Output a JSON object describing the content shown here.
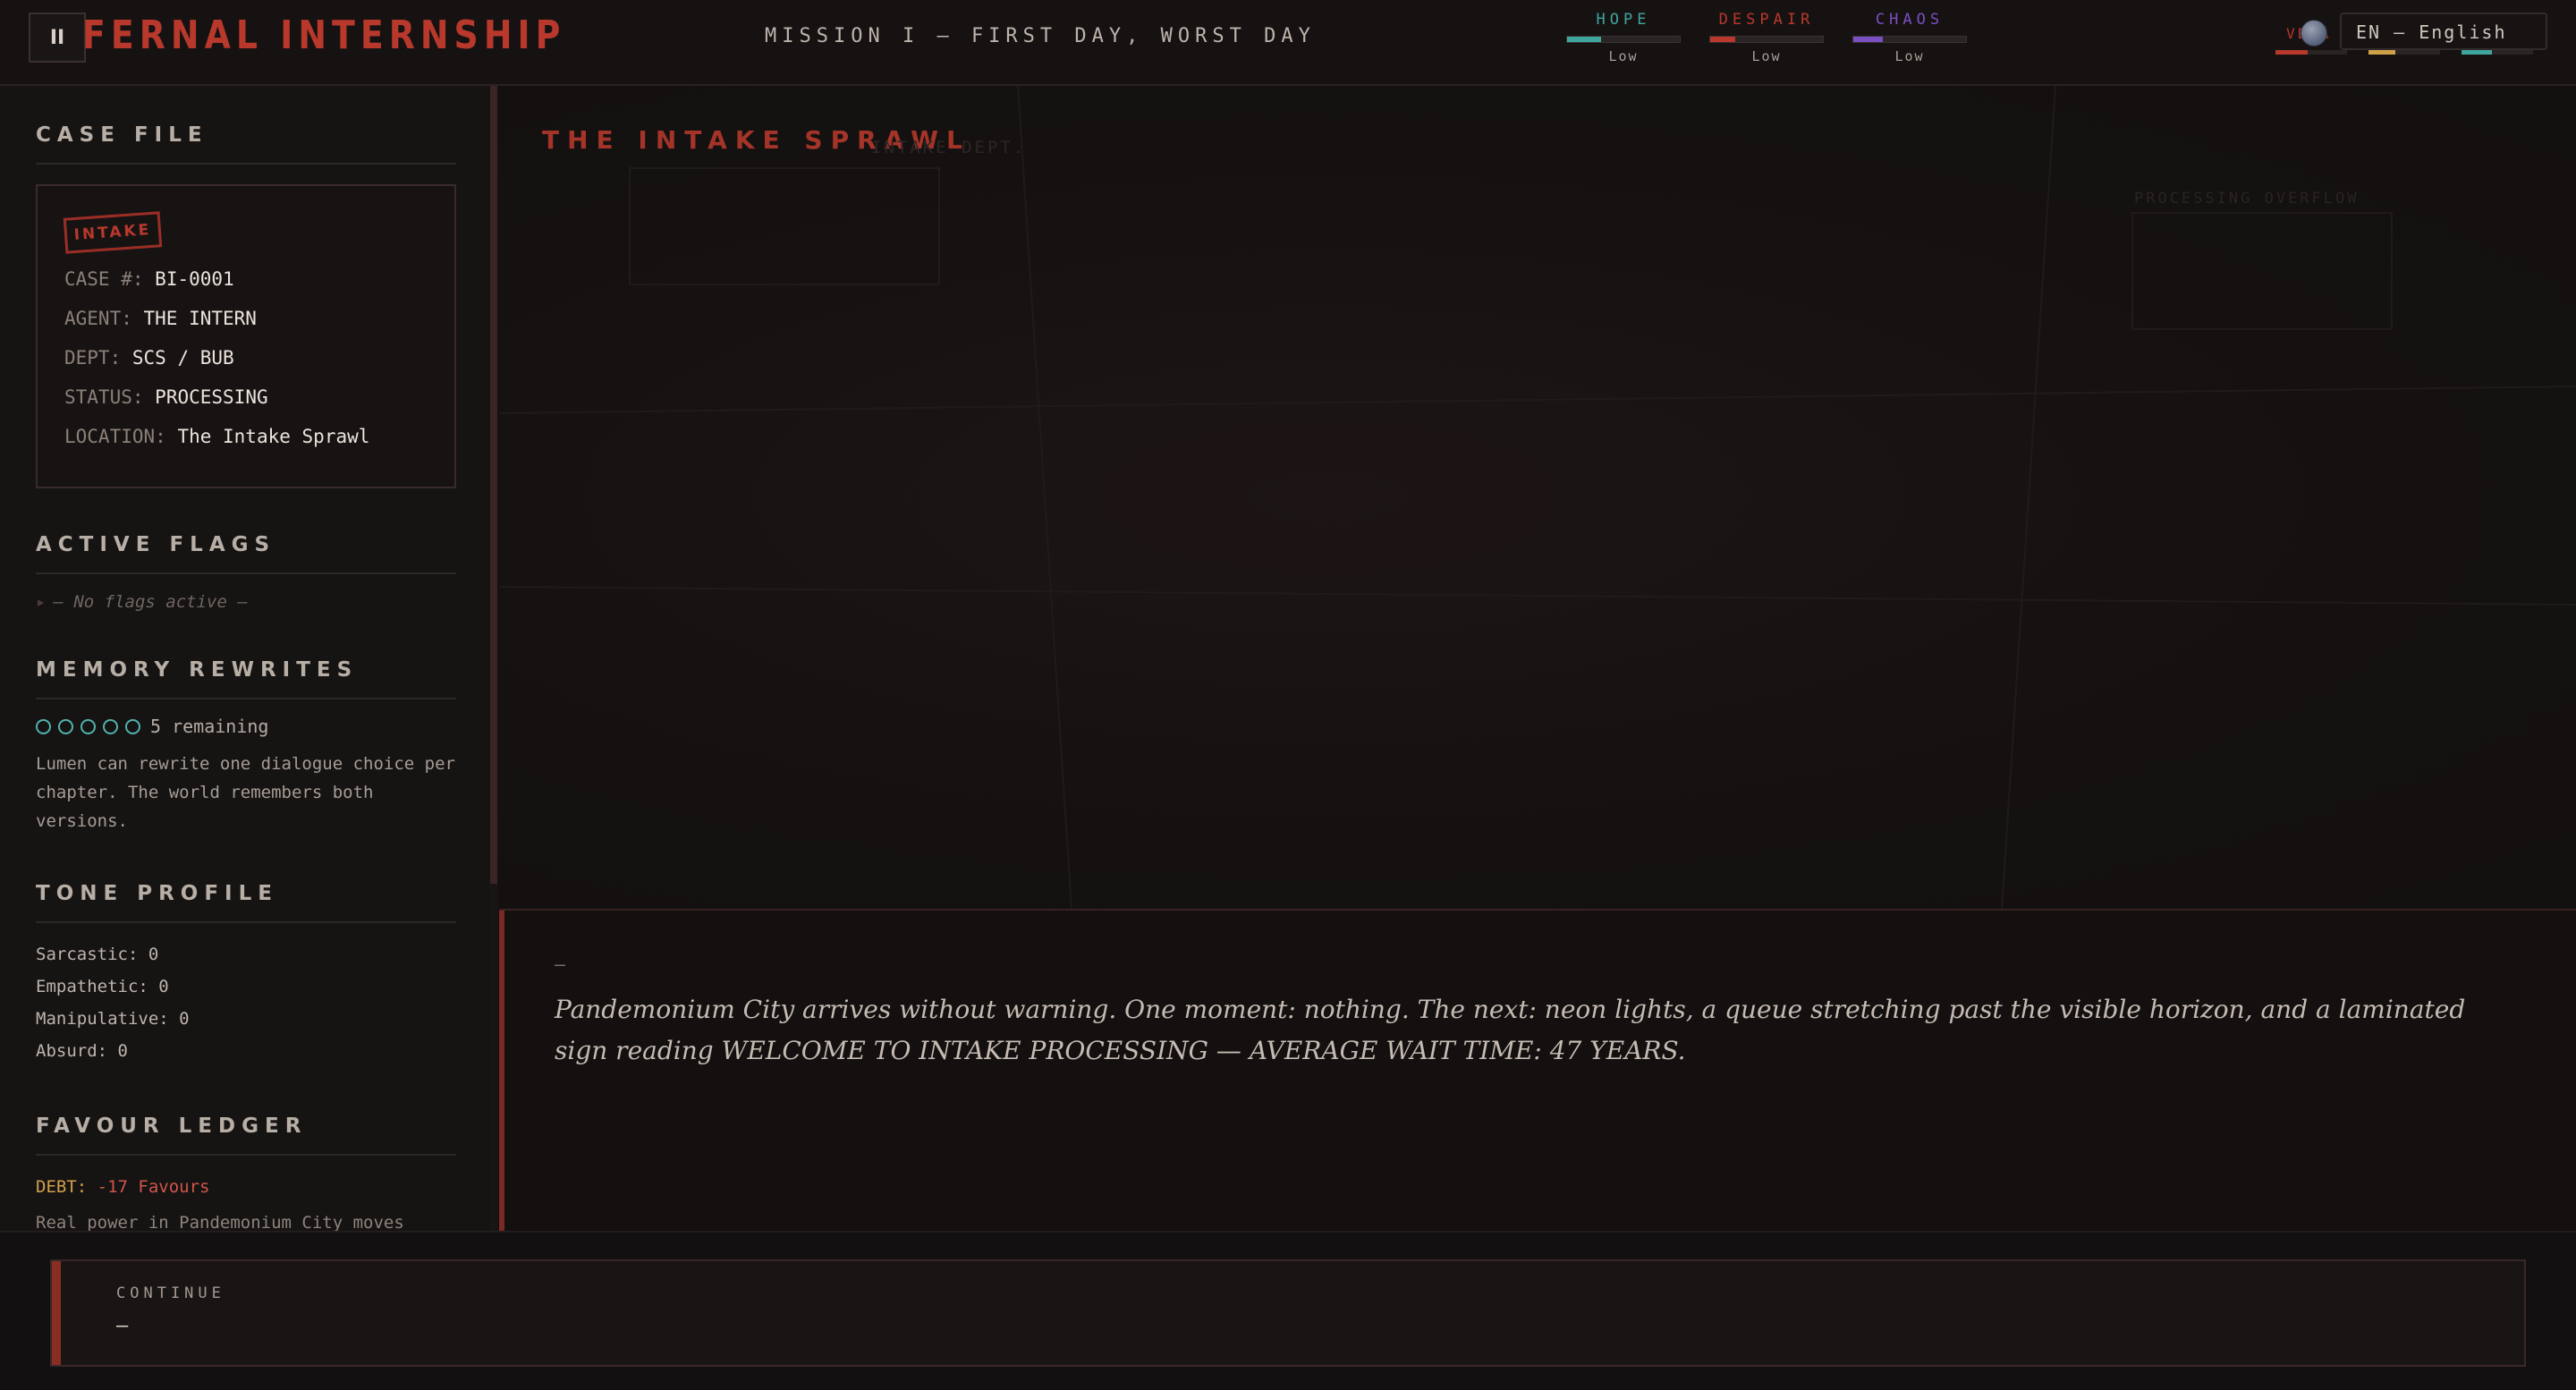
{
  "header": {
    "menu_glyph": "II",
    "game_title": "FERNAL INTERNSHIP",
    "mission_title": "MISSION I — FIRST DAY, WORST DAY",
    "meters": [
      {
        "name": "HOPE",
        "level": "Low",
        "fill": 0.3,
        "color": "#3fa69f"
      },
      {
        "name": "DESPAIR",
        "level": "Low",
        "fill": 0.22,
        "color": "#b8382c"
      },
      {
        "name": "CHAOS",
        "level": "Low",
        "fill": 0.26,
        "color": "#7a4fc2"
      }
    ],
    "companion": {
      "name": "VERA",
      "avatar_icon": "avatar-icon"
    },
    "mini_bars": [
      {
        "fill": 0.45,
        "color": "#b8382c"
      },
      {
        "fill": 0.38,
        "color": "#d1a14a"
      },
      {
        "fill": 0.42,
        "color": "#3fa69f"
      }
    ],
    "language": "EN — English"
  },
  "sidebar": {
    "case_file": {
      "title": "CASE FILE",
      "stamp": "INTAKE",
      "rows": [
        {
          "key": "CASE #:",
          "value": "BI-0001"
        },
        {
          "key": "AGENT:",
          "value": "THE INTERN"
        },
        {
          "key": "DEPT:",
          "value": "SCS / BUB"
        },
        {
          "key": "STATUS:",
          "value": "PROCESSING"
        },
        {
          "key": "LOCATION:",
          "value": "The Intake Sprawl"
        }
      ]
    },
    "active_flags": {
      "title": "ACTIVE FLAGS",
      "arrow": "▸",
      "empty": "— No flags active —"
    },
    "memory_rewrites": {
      "title": "MEMORY REWRITES",
      "remaining": "5 remaining",
      "description": "Lumen can rewrite one dialogue choice per chapter. The world remembers both versions."
    },
    "tone_profile": {
      "title": "TONE PROFILE",
      "rows": [
        "Sarcastic: 0",
        "Empathetic: 0",
        "Manipulative: 0",
        "Absurd: 0"
      ]
    },
    "favour_ledger": {
      "title": "FAVOUR LEDGER",
      "debt_key": "DEBT:",
      "debt_value": "-17 Favours",
      "description": "Real power in Pandemonium City moves"
    }
  },
  "scene": {
    "title": "THE INTAKE SPRAWL",
    "ghost_label_1": "INTAKE DEPT.",
    "ghost_label_2": "PROCESSING OVERFLOW"
  },
  "narration": {
    "speaker": "—",
    "text": "Pandemonium City arrives without warning. One moment: nothing. The next: neon lights, a queue stretching past the visible horizon, and a laminated sign reading WELCOME TO INTAKE PROCESSING — AVERAGE WAIT TIME: 47 YEARS."
  },
  "choices": [
    {
      "label": "CONTINUE",
      "text": "—"
    }
  ]
}
